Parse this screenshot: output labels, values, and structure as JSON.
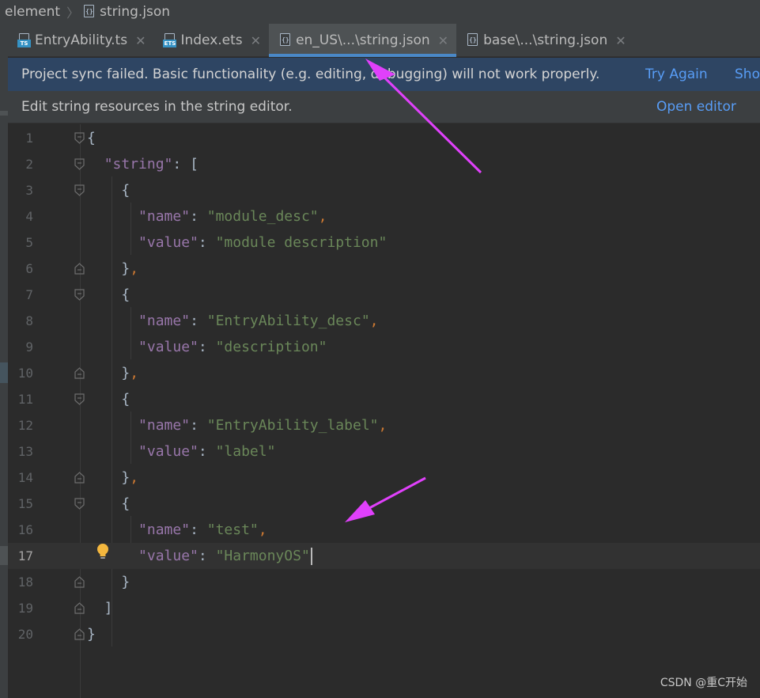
{
  "breadcrumb": {
    "folder": "element",
    "file": "string.json"
  },
  "tabs": [
    {
      "label": "EntryAbility.ts",
      "icon": "ts-file-icon"
    },
    {
      "label": "Index.ets",
      "icon": "ets-file-icon"
    },
    {
      "label": "en_US\\...\\string.json",
      "icon": "json-file-icon",
      "active": true
    },
    {
      "label": "base\\...\\string.json",
      "icon": "json-file-icon"
    }
  ],
  "sync_banner": {
    "message": "Project sync failed. Basic functionality (e.g. editing, debugging) will not work properly.",
    "try_again": "Try Again",
    "show": "Sho"
  },
  "editor_banner": {
    "message": "Edit string resources in the string editor.",
    "open_editor": "Open editor"
  },
  "code": {
    "current_line": 17,
    "line_numbers": [
      "1",
      "2",
      "3",
      "4",
      "5",
      "6",
      "7",
      "8",
      "9",
      "10",
      "11",
      "12",
      "13",
      "14",
      "15",
      "16",
      "17",
      "18",
      "19",
      "20"
    ],
    "key_string": "\"string\"",
    "key_name": "\"name\"",
    "key_value": "\"value\"",
    "entries": [
      {
        "name": "\"module_desc\"",
        "value": "\"module description\""
      },
      {
        "name": "\"EntryAbility_desc\"",
        "value": "\"description\""
      },
      {
        "name": "\"EntryAbility_label\"",
        "value": "\"label\""
      },
      {
        "name": "\"test\"",
        "value": "\"HarmonyOS\""
      }
    ]
  },
  "watermark": "CSDN @重C开始",
  "colors": {
    "accent": "#4a88c7",
    "banner_bg": "#2e4563",
    "link": "#589df6",
    "annotation_arrow": "#e040fb"
  }
}
